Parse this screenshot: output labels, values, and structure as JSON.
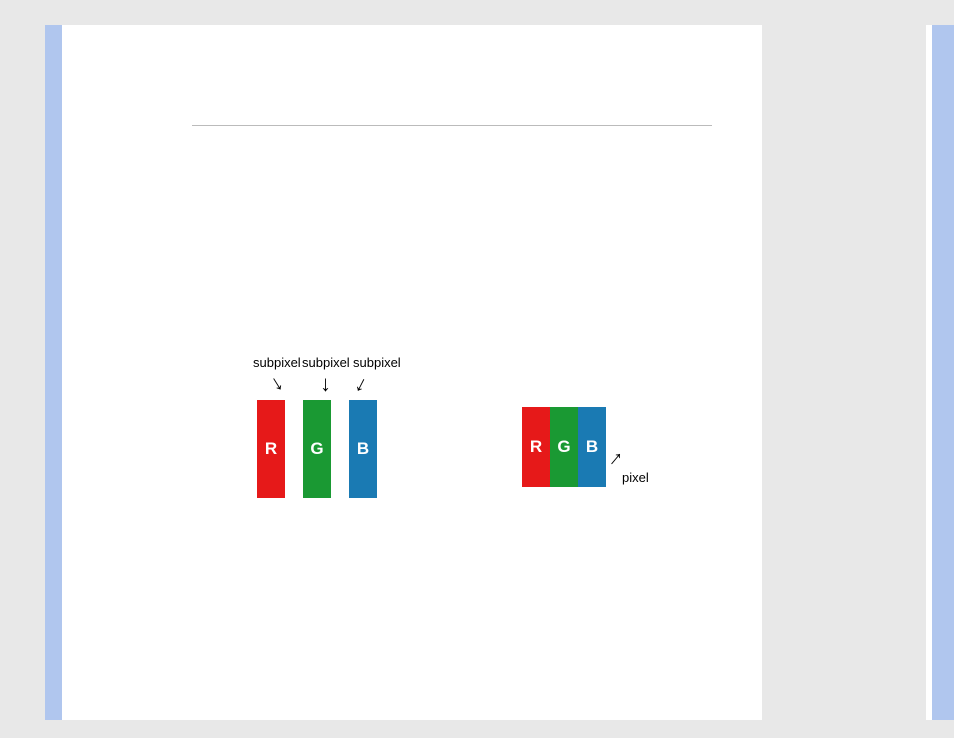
{
  "diagram": {
    "subpixel_labels": [
      "subpixel",
      "subpixel",
      "subpixel"
    ],
    "pixel_label": "pixel",
    "letters": {
      "r": "R",
      "g": "G",
      "b": "B"
    },
    "colors": {
      "red": "#e61919",
      "green": "#1a9933",
      "blue": "#1a7ab3"
    }
  }
}
